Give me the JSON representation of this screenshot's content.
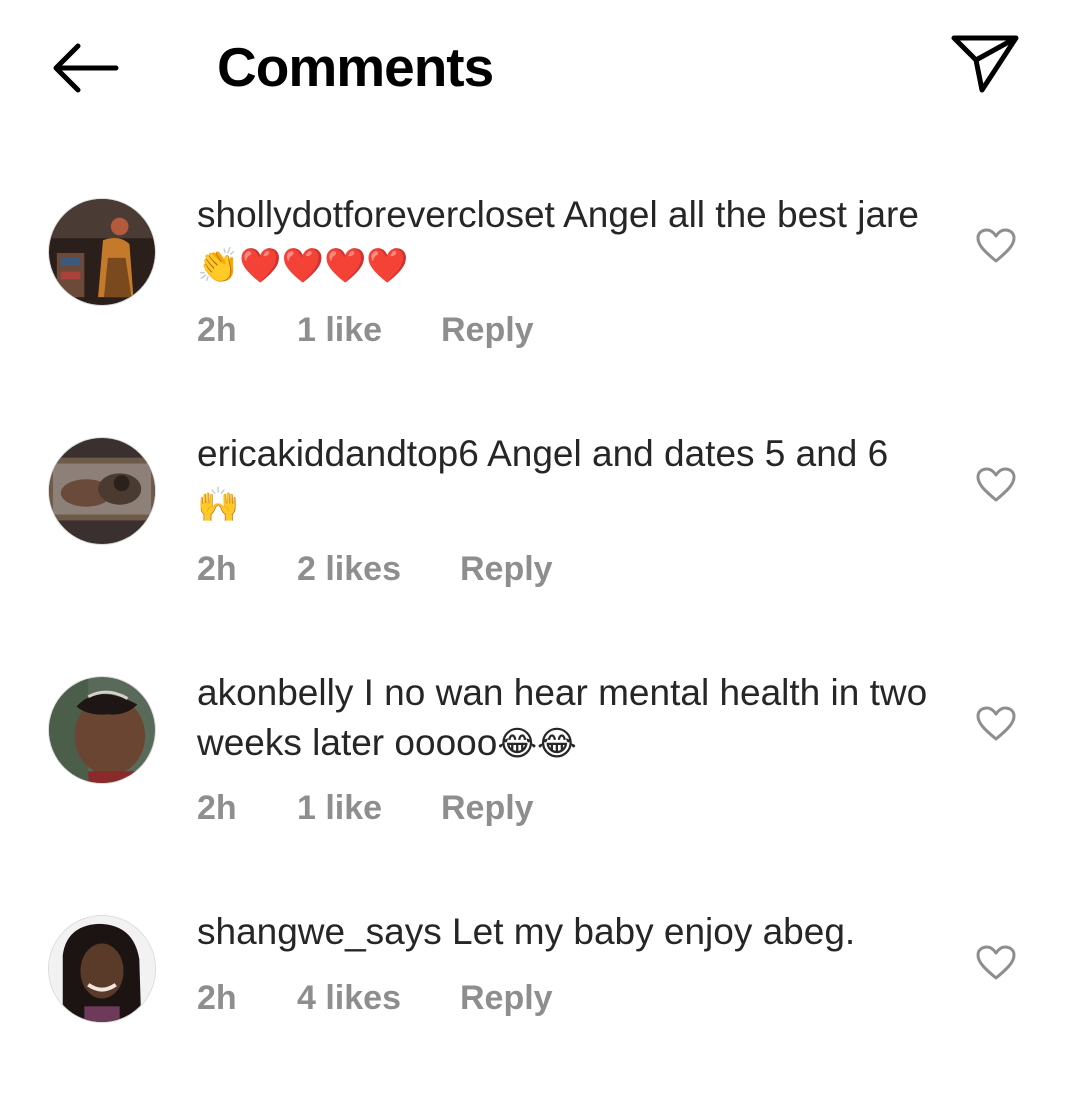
{
  "header": {
    "title": "Comments"
  },
  "comments": [
    {
      "username": "shollydotforevercloset",
      "text": "Angel all the best jare",
      "emoji": "👏❤️❤️❤️❤️",
      "time": "2h",
      "likes": "1 like",
      "reply": "Reply"
    },
    {
      "username": "ericakiddandtop6",
      "text": "Angel and dates 5 and 6",
      "emoji": "🙌",
      "time": "2h",
      "likes": "2 likes",
      "reply": "Reply"
    },
    {
      "username": "akonbelly",
      "text": "I no wan hear mental health in two weeks later ooooo",
      "emoji": "😂😂",
      "time": "2h",
      "likes": "1 like",
      "reply": "Reply"
    },
    {
      "username": "shangwe_says",
      "text": "Let my baby enjoy abeg.",
      "emoji": "",
      "time": "2h",
      "likes": "4 likes",
      "reply": "Reply"
    }
  ]
}
